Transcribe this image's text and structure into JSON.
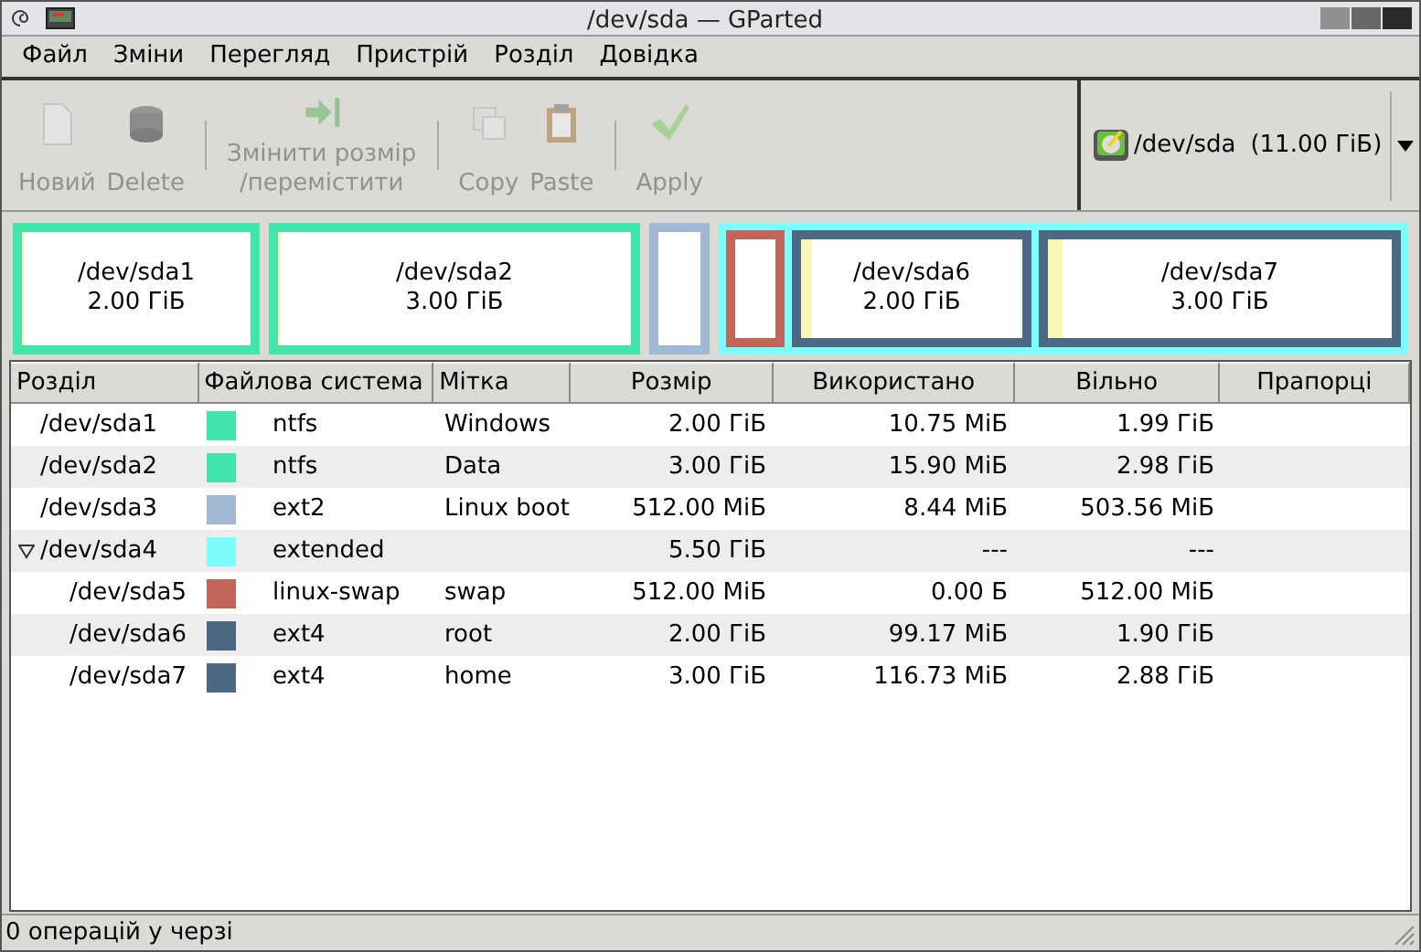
{
  "window": {
    "title": "/dev/sda — GParted"
  },
  "menu": [
    "Файл",
    "Зміни",
    "Перегляд",
    "Пристрій",
    "Розділ",
    "Довідка"
  ],
  "toolbar": [
    {
      "kind": "new",
      "label": "Новий",
      "disabled": true
    },
    {
      "kind": "delete",
      "label": "Delete",
      "disabled": true
    },
    {
      "kind": "sep"
    },
    {
      "kind": "resize",
      "label": "Змінити розмір\n/перемістити",
      "disabled": true
    },
    {
      "kind": "sep"
    },
    {
      "kind": "copy",
      "label": "Copy",
      "disabled": true
    },
    {
      "kind": "paste",
      "label": "Paste",
      "disabled": true
    },
    {
      "kind": "sep"
    },
    {
      "kind": "apply",
      "label": "Apply",
      "disabled": true
    }
  ],
  "device": {
    "name": "/dev/sda",
    "size": "(11.00 ГіБ)"
  },
  "map": [
    {
      "name": "/dev/sda1",
      "size": "2.00 ГіБ",
      "color": "#42e5ac",
      "level": 0.005
    },
    {
      "name": "/dev/sda2",
      "size": "3.00 ГіБ",
      "color": "#42e5ac",
      "level": 0.005
    },
    {
      "color": "#a0b8d4"
    },
    {
      "kind": "extended",
      "color": "#7dfcfe",
      "children": [
        {
          "color": "#c1665a"
        },
        {
          "name": "/dev/sda6",
          "size": "2.00 ГіБ",
          "color": "#4b6983",
          "level": 0.05
        },
        {
          "name": "/dev/sda7",
          "size": "3.00 ГіБ",
          "color": "#4b6983",
          "level": 0.04
        }
      ]
    }
  ],
  "table": {
    "columns": [
      "Розділ",
      "Файлова система",
      "Мітка",
      "Розмір",
      "Використано",
      "Вільно",
      "Прапорці"
    ],
    "rows": [
      {
        "partition": "/dev/sda1",
        "color": "#42e5ac",
        "fs": "ntfs",
        "label": "Windows",
        "size": "2.00 ГіБ",
        "used": "10.75 МіБ",
        "free": "1.99 ГіБ"
      },
      {
        "partition": "/dev/sda2",
        "color": "#42e5ac",
        "fs": "ntfs",
        "label": "Data",
        "size": "3.00 ГіБ",
        "used": "15.90 МіБ",
        "free": "2.98 ГіБ"
      },
      {
        "partition": "/dev/sda3",
        "color": "#a0b8d4",
        "fs": "ext2",
        "label": "Linux boot",
        "size": "512.00 МіБ",
        "used": "8.44 МіБ",
        "free": "503.56 МіБ"
      },
      {
        "partition": "/dev/sda4",
        "color": "#7dfcfe",
        "fs": "extended",
        "size": "5.50 ГіБ",
        "used": "---",
        "free": "---",
        "expanded": true,
        "children": [
          {
            "partition": "/dev/sda5",
            "color": "#c1665a",
            "fs": "linux-swap",
            "label": "swap",
            "size": "512.00 МіБ",
            "used": "0.00 Б",
            "free": "512.00 МіБ"
          },
          {
            "partition": "/dev/sda6",
            "color": "#4b6983",
            "fs": "ext4",
            "label": "root",
            "size": "2.00 ГіБ",
            "used": "99.17 МіБ",
            "free": "1.90 ГіБ"
          },
          {
            "partition": "/dev/sda7",
            "color": "#4b6983",
            "fs": "ext4",
            "label": "home",
            "size": "3.00 ГіБ",
            "used": "116.73 МіБ",
            "free": "2.88 ГіБ"
          }
        ]
      }
    ]
  },
  "status_bar": "0 операцій у черзі"
}
